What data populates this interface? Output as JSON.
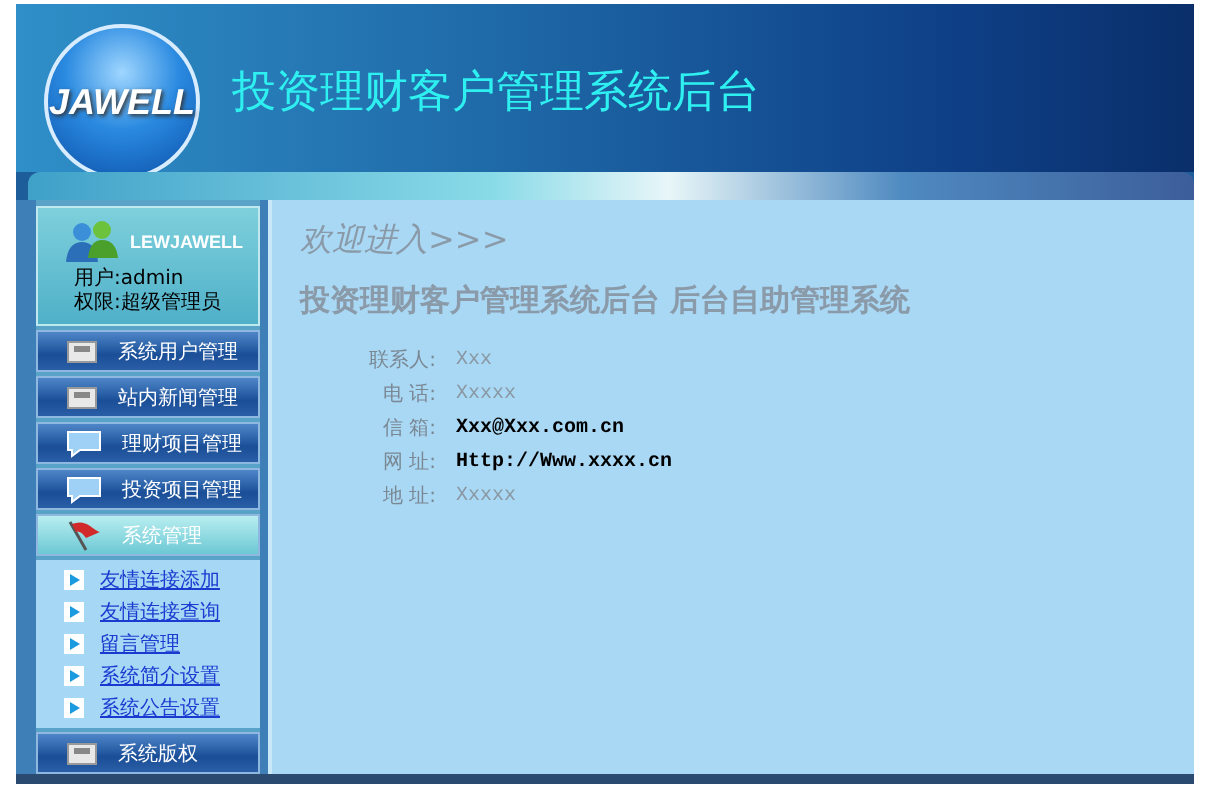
{
  "header": {
    "logo": "JAWELL",
    "title": "投资理财客户管理系统后台"
  },
  "user_panel": {
    "name": "LEWJAWELL",
    "user": "用户:admin",
    "role": "权限:超级管理员"
  },
  "menu": [
    {
      "label": "系统用户管理",
      "kind": "document",
      "expanded": false
    },
    {
      "label": "站内新闻管理",
      "kind": "document",
      "expanded": false
    },
    {
      "label": "理财项目管理",
      "kind": "message",
      "expanded": false
    },
    {
      "label": "投资项目管理",
      "kind": "message",
      "expanded": false
    },
    {
      "label": "系统管理",
      "kind": "flag",
      "expanded": true,
      "children": [
        "友情连接添加",
        "友情连接查询",
        "留言管理",
        "系统简介设置",
        "系统公告设置"
      ]
    },
    {
      "label": "系统版权",
      "kind": "document",
      "expanded": false
    }
  ],
  "content": {
    "welcome": "欢迎进入>>>",
    "heading": "投资理财客户管理系统后台 后台自助管理系统",
    "contacts": [
      {
        "label": "联系人:",
        "value": "Xxx",
        "highlighted": false
      },
      {
        "label": "电 话:",
        "value": "Xxxxx",
        "highlighted": false
      },
      {
        "label": "信 箱:",
        "value": "Xxx@Xxx.com.cn",
        "highlighted": true
      },
      {
        "label": "网 址:",
        "value": "Http://Www.xxxx.cn",
        "highlighted": true
      },
      {
        "label": "地 址:",
        "value": "Xxxxx",
        "highlighted": false
      }
    ]
  }
}
